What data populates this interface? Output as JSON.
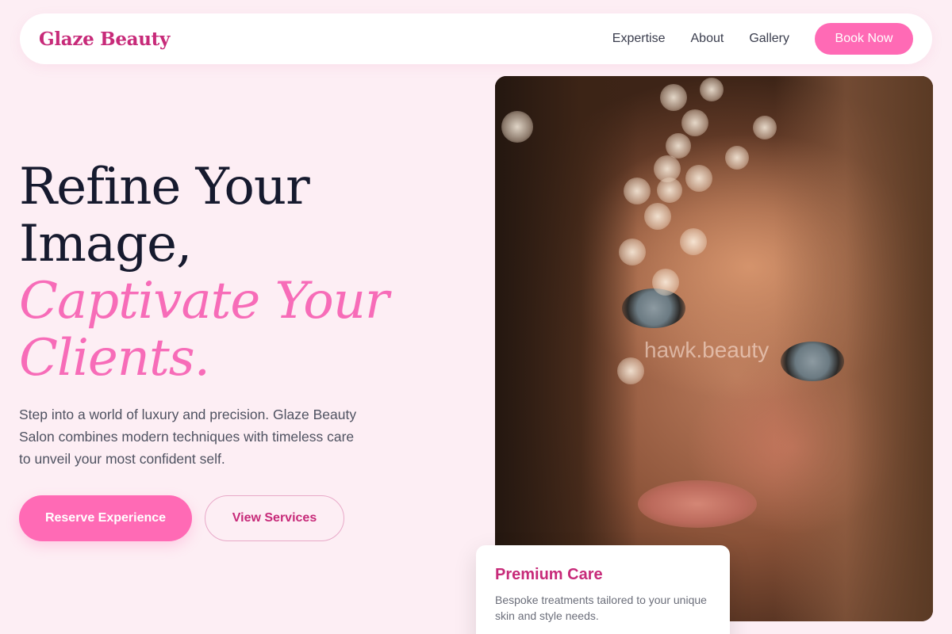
{
  "nav": {
    "logo": "Glaze Beauty",
    "links": [
      "Expertise",
      "About",
      "Gallery"
    ],
    "cta": "Book Now"
  },
  "hero": {
    "title_line1": "Refine Your",
    "title_line2": "Image,",
    "title_line3": "Captivate Your",
    "title_line4": "Clients.",
    "description": "Step into a world of luxury and precision. Glaze Beauty Salon combines modern techniques with timeless care to unveil your most confident self.",
    "primary_button": "Reserve Experience",
    "secondary_button": "View Services",
    "image_watermark": "hawk.beauty"
  },
  "card": {
    "title": "Premium Care",
    "text": "Bespoke treatments tailored to your unique skin and style needs."
  },
  "colors": {
    "background": "#fdeef4",
    "accent": "#ff6ab5",
    "brand": "#c72a79",
    "heading": "#161a2e"
  }
}
